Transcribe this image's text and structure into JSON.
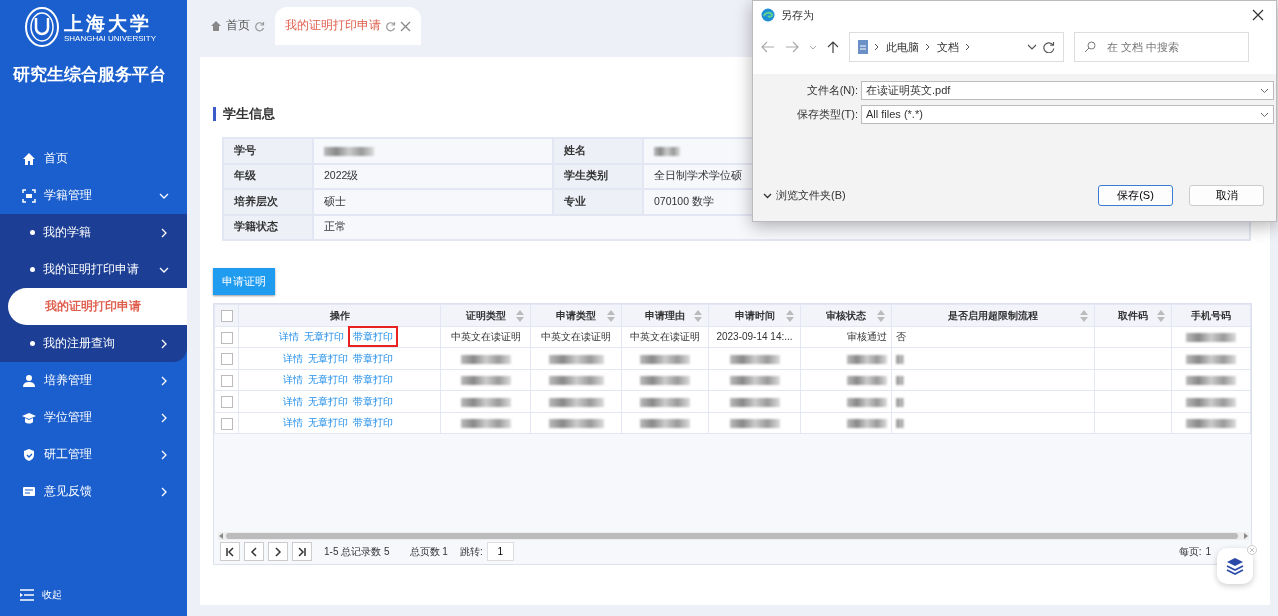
{
  "sidebar": {
    "logo_text": "上海大学",
    "logo_subtext": "SHANGHAI UNIVERSITY",
    "platform_title": "研究生综合服务平台",
    "items": [
      {
        "label": "首页",
        "selected": false
      },
      {
        "label": "学籍管理",
        "expanded": true,
        "selected": false,
        "children": [
          {
            "label": "我的学籍",
            "expanded": false,
            "selected": false
          },
          {
            "label": "我的证明打印申请",
            "expanded": true,
            "selected": false,
            "children": [
              {
                "label": "我的证明打印申请",
                "selected": true
              }
            ]
          },
          {
            "label": "我的注册查询",
            "expanded": false,
            "selected": false
          }
        ]
      },
      {
        "label": "培养管理",
        "expanded": false,
        "selected": false
      },
      {
        "label": "学位管理",
        "expanded": false,
        "selected": false
      },
      {
        "label": "研工管理",
        "expanded": false,
        "selected": false
      },
      {
        "label": "意见反馈",
        "expanded": false,
        "selected": false
      }
    ],
    "collapse_label": "收起"
  },
  "tabs": [
    {
      "label": "首页",
      "closable": false,
      "selected": false
    },
    {
      "label": "我的证明打印申请",
      "closable": true,
      "selected": true
    }
  ],
  "section_title": "学生信息",
  "fields": [
    {
      "label": "学号",
      "kind": "blurred"
    },
    {
      "label": "姓名",
      "kind": "blurred"
    },
    {
      "label": "年级",
      "kind": "text",
      "value": "2022级"
    },
    {
      "label": "学生类别",
      "kind": "text",
      "value": "全日制学术学位硕"
    },
    {
      "label": "培养层次",
      "kind": "text",
      "value": "硕士"
    },
    {
      "label": "专业",
      "kind": "text",
      "value": "070100 数学"
    },
    {
      "label": "学籍状态",
      "kind": "text",
      "value": "正常"
    }
  ],
  "apply_button": "申请证明",
  "table": {
    "columns": [
      {
        "kind": "checkbox",
        "checked": false
      },
      {
        "kind": "text",
        "label": "操作",
        "sortable": false
      },
      {
        "kind": "text",
        "label": "证明类型",
        "sortable": true
      },
      {
        "kind": "text",
        "label": "申请类型",
        "sortable": true
      },
      {
        "kind": "text",
        "label": "申请理由",
        "sortable": true
      },
      {
        "kind": "text",
        "label": "申请时间",
        "sortable": true
      },
      {
        "kind": "text",
        "label": "审核状态",
        "sortable": true
      },
      {
        "kind": "text",
        "label": "是否启用超限制流程",
        "sortable": true
      },
      {
        "kind": "text",
        "label": "取件码",
        "sortable": true
      },
      {
        "kind": "text",
        "label": "手机号码",
        "sortable": false
      }
    ],
    "rows": [
      {
        "cells": [
          {
            "kind": "checkbox",
            "checked": false
          },
          {
            "kind": "actions",
            "actions": [
              {
                "label": "详情",
                "highlighted": false
              },
              {
                "label": "无章打印",
                "highlighted": false
              },
              {
                "label": "带章打印",
                "highlighted": true
              }
            ]
          },
          {
            "kind": "text",
            "text": "中英文在读证明"
          },
          {
            "kind": "text",
            "text": "中英文在读证明"
          },
          {
            "kind": "text",
            "text": "中英文在读证明"
          },
          {
            "kind": "text",
            "text": "2023-09-14 14:..."
          },
          {
            "kind": "text",
            "text": "审核通过"
          },
          {
            "kind": "text",
            "text": "否"
          },
          {
            "kind": "empty"
          },
          {
            "kind": "blurred"
          }
        ]
      },
      {
        "cells": [
          {
            "kind": "checkbox",
            "checked": false
          },
          {
            "kind": "actions",
            "actions": [
              {
                "label": "详情",
                "highlighted": false
              },
              {
                "label": "无章打印",
                "highlighted": false
              },
              {
                "label": "带章打印",
                "highlighted": false
              }
            ]
          },
          {
            "kind": "blurred"
          },
          {
            "kind": "blurred"
          },
          {
            "kind": "blurred"
          },
          {
            "kind": "blurred"
          },
          {
            "kind": "blurred"
          },
          {
            "kind": "blurred"
          },
          {
            "kind": "empty"
          },
          {
            "kind": "blurred"
          }
        ]
      },
      {
        "cells": [
          {
            "kind": "checkbox",
            "checked": false
          },
          {
            "kind": "actions",
            "actions": [
              {
                "label": "详情",
                "highlighted": false
              },
              {
                "label": "无章打印",
                "highlighted": false
              },
              {
                "label": "带章打印",
                "highlighted": false
              }
            ]
          },
          {
            "kind": "blurred"
          },
          {
            "kind": "blurred"
          },
          {
            "kind": "blurred"
          },
          {
            "kind": "blurred"
          },
          {
            "kind": "blurred"
          },
          {
            "kind": "blurred"
          },
          {
            "kind": "empty"
          },
          {
            "kind": "blurred"
          }
        ]
      },
      {
        "cells": [
          {
            "kind": "checkbox",
            "checked": false
          },
          {
            "kind": "actions",
            "actions": [
              {
                "label": "详情",
                "highlighted": false
              },
              {
                "label": "无章打印",
                "highlighted": false
              },
              {
                "label": "带章打印",
                "highlighted": false
              }
            ]
          },
          {
            "kind": "blurred"
          },
          {
            "kind": "blurred"
          },
          {
            "kind": "blurred"
          },
          {
            "kind": "blurred"
          },
          {
            "kind": "blurred"
          },
          {
            "kind": "blurred"
          },
          {
            "kind": "empty"
          },
          {
            "kind": "blurred"
          }
        ]
      },
      {
        "cells": [
          {
            "kind": "checkbox",
            "checked": false
          },
          {
            "kind": "actions",
            "actions": [
              {
                "label": "详情",
                "highlighted": false
              },
              {
                "label": "无章打印",
                "highlighted": false
              },
              {
                "label": "带章打印",
                "highlighted": false
              }
            ]
          },
          {
            "kind": "blurred"
          },
          {
            "kind": "blurred"
          },
          {
            "kind": "blurred"
          },
          {
            "kind": "blurred"
          },
          {
            "kind": "blurred"
          },
          {
            "kind": "blurred"
          },
          {
            "kind": "empty"
          },
          {
            "kind": "blurred"
          }
        ]
      }
    ]
  },
  "pager": {
    "range": "1-5 总记录数 5",
    "pages": "总页数 1",
    "jump_label": "跳转:",
    "jump_value": "1",
    "page_size_label": "每页:",
    "page_size_value": "1"
  },
  "dialog": {
    "title": "另存为",
    "breadcrumb": [
      "此电脑",
      "文档"
    ],
    "search_placeholder": "在 文档 中搜索",
    "filename_label": "文件名(N):",
    "filename": "在读证明英文.pdf",
    "type_label": "保存类型(T):",
    "type": "All files (*.*)",
    "browse_label": "浏览文件夹(B)",
    "save_button": "保存(S)",
    "cancel_button": "取消"
  }
}
